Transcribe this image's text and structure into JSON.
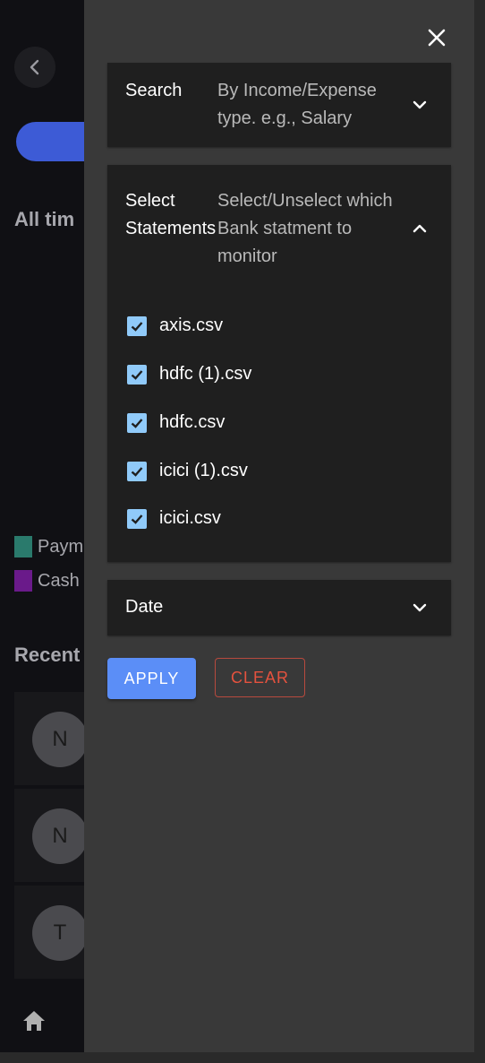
{
  "background_app": {
    "all_time_label": "All tim",
    "legend": [
      {
        "label": "Paym",
        "color": "#2a7a6c"
      },
      {
        "label": "Cash",
        "color": "#6a1a8a"
      }
    ],
    "recent_label": "Recent",
    "transactions": [
      {
        "avatar_letter": "N"
      },
      {
        "avatar_letter": "N"
      },
      {
        "avatar_letter": "T"
      }
    ]
  },
  "drawer": {
    "search": {
      "title": "Search",
      "description": "By Income/Expense type. e.g., Salary"
    },
    "statements": {
      "title": "Select Statements",
      "description": "Select/Unselect which Bank statment to monitor",
      "items": [
        {
          "label": "axis.csv",
          "checked": true
        },
        {
          "label": "hdfc (1).csv",
          "checked": true
        },
        {
          "label": "hdfc.csv",
          "checked": true
        },
        {
          "label": "icici (1).csv",
          "checked": true
        },
        {
          "label": "icici.csv",
          "checked": true
        }
      ]
    },
    "date": {
      "title": "Date"
    },
    "apply_label": "APPLY",
    "clear_label": "CLEAR"
  },
  "colors": {
    "accent": "#5b8ef7",
    "checkbox": "#90caf9",
    "danger": "#e5523e"
  },
  "icons": [
    "close-icon",
    "chevron-down-icon",
    "chevron-up-icon",
    "check-icon",
    "back-arrow-icon",
    "home-icon"
  ]
}
